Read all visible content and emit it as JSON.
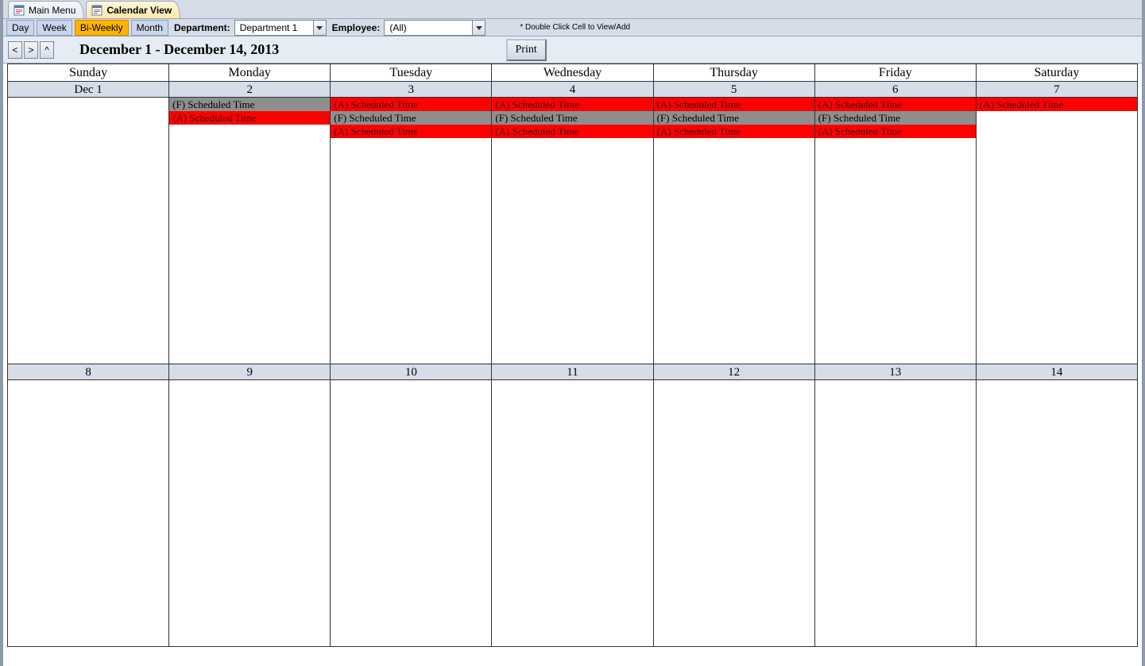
{
  "tabs": {
    "main_menu": "Main Menu",
    "calendar_view": "Calendar View"
  },
  "views": {
    "day": "Day",
    "week": "Week",
    "biweekly": "Bi-Weekly",
    "month": "Month"
  },
  "filters": {
    "department_label": "Department:",
    "department_value": "Department 1",
    "employee_label": "Employee:",
    "employee_value": "(All)"
  },
  "hint": "* Double Click Cell to View/Add",
  "nav": {
    "prev": "<",
    "next": ">",
    "up": "^",
    "range_title": "December 1 - December 14, 2013",
    "print": "Print"
  },
  "day_headers": [
    "Sunday",
    "Monday",
    "Tuesday",
    "Wednesday",
    "Thursday",
    "Friday",
    "Saturday"
  ],
  "weeks": [
    {
      "dates": [
        "Dec 1",
        "2",
        "3",
        "4",
        "5",
        "6",
        "7"
      ],
      "events": [
        [],
        [
          {
            "label": "(F) Scheduled Time",
            "style": "gray"
          },
          {
            "label": "(A) Scheduled Time",
            "style": "red"
          }
        ],
        [
          {
            "label": "(A) Scheduled Time",
            "style": "red"
          },
          {
            "label": "(F) Scheduled Time",
            "style": "gray"
          },
          {
            "label": "(A) Scheduled Time",
            "style": "red"
          }
        ],
        [
          {
            "label": "(A) Scheduled Time",
            "style": "red"
          },
          {
            "label": "(F) Scheduled Time",
            "style": "gray"
          },
          {
            "label": "(A) Scheduled Time",
            "style": "red"
          }
        ],
        [
          {
            "label": "(A) Scheduled Time",
            "style": "red"
          },
          {
            "label": "(F) Scheduled Time",
            "style": "gray"
          },
          {
            "label": "(A) Scheduled Time",
            "style": "red"
          }
        ],
        [
          {
            "label": "(A) Scheduled Time",
            "style": "red"
          },
          {
            "label": "(F) Scheduled Time",
            "style": "gray"
          },
          {
            "label": "(A) Scheduled Time",
            "style": "red"
          }
        ],
        [
          {
            "label": "(A) Scheduled Time",
            "style": "red"
          }
        ]
      ]
    },
    {
      "dates": [
        "8",
        "9",
        "10",
        "11",
        "12",
        "13",
        "14"
      ],
      "events": [
        [],
        [],
        [],
        [],
        [],
        [],
        []
      ]
    }
  ],
  "colors": {
    "accent_orange": "#ffb400",
    "event_red": "#ff0000",
    "event_gray": "#8e8e8e",
    "panel_blue": "#d6dde8"
  }
}
